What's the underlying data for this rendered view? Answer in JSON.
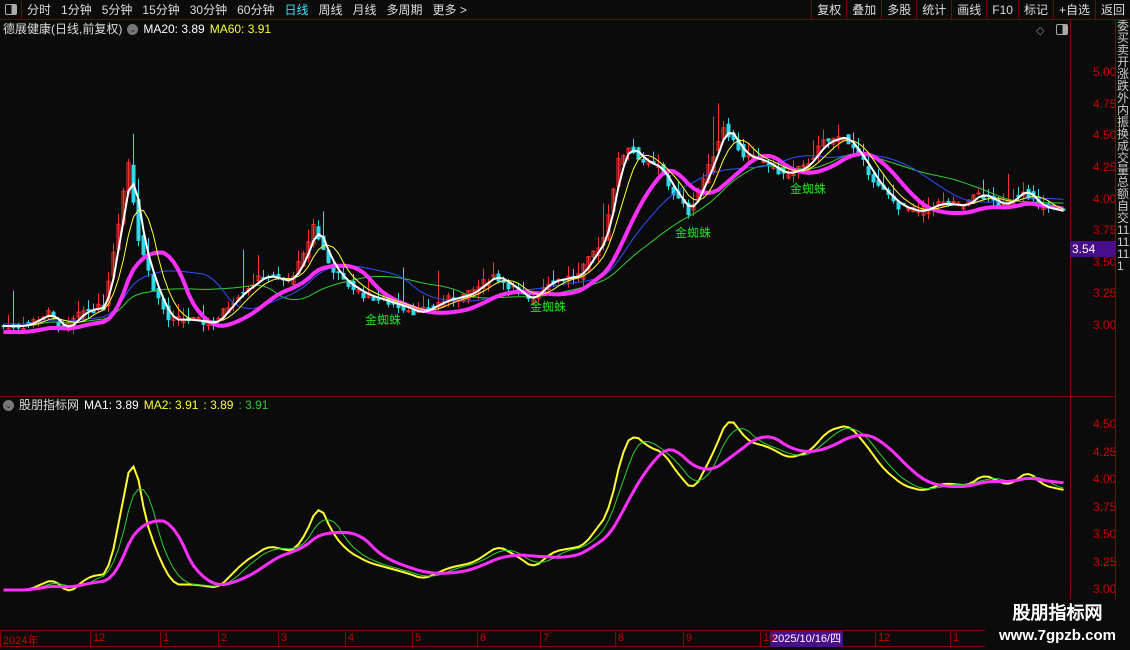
{
  "toolbar": {
    "periods": [
      "分时",
      "1分钟",
      "5分钟",
      "15分钟",
      "30分钟",
      "60分钟",
      "日线",
      "周线",
      "月线",
      "多周期",
      "更多 >"
    ],
    "active": "日线",
    "right_buttons": [
      "复权",
      "叠加",
      "多股",
      "统计",
      "画线",
      "F10",
      "标记",
      "+自选",
      "返回"
    ]
  },
  "main": {
    "title": "德展健康(日线,前复权)",
    "ma20": "MA20: 3.89",
    "ma60": "MA60: 3.91",
    "price_badge": "3.54",
    "y_ticks": [
      "5.00",
      "4.75",
      "4.50",
      "4.25",
      "4.00",
      "3.75",
      "3.50",
      "3.25",
      "3.00"
    ],
    "signals": [
      {
        "label": "金蜘蛛",
        "bar": 75
      },
      {
        "label": "金蜘蛛",
        "bar": 108
      },
      {
        "label": "金蜘蛛",
        "bar": 137
      },
      {
        "label": "金蜘蛛",
        "bar": 160
      }
    ]
  },
  "sub": {
    "title": "股朋指标网",
    "ma1": "MA1: 3.89",
    "ma2": "MA2: 3.91",
    "v3": ": 3.89",
    "v4": ": 3.91",
    "y_ticks": [
      "4.50",
      "4.25",
      "4.00",
      "3.75",
      "3.50",
      "3.25",
      "3.00"
    ]
  },
  "dates": {
    "labels": [
      "2024年",
      "12",
      "1",
      "2",
      "3",
      "4",
      "5",
      "6",
      "7",
      "8",
      "9",
      "10",
      "12",
      "1"
    ],
    "selected": "2025/10/16/四"
  },
  "right_column": "委买卖开涨跌外内振换成交量总额自交1111111",
  "watermark": {
    "line1": "股朋指标网",
    "line2": "www.7gpzb.com"
  },
  "colors": {
    "up": "#ff3030",
    "down": "#30d8e8",
    "ma_white": "#ffffff",
    "ma_yellow": "#ffff30",
    "ma_magenta": "#ff30ff",
    "ma_green": "#30d030",
    "ma_blue": "#3050ff"
  },
  "chart_data": {
    "type": "candlestick",
    "title": "德展健康 日线",
    "ylim": [
      2.7,
      5.4
    ],
    "anchors_bar": [
      0,
      4,
      9,
      12,
      16,
      20,
      22,
      25,
      27,
      30,
      33,
      37,
      42,
      47,
      52,
      57,
      60,
      62,
      65,
      68,
      72,
      76,
      80,
      83,
      88,
      93,
      98,
      102,
      105,
      109,
      115,
      120,
      123,
      125,
      128,
      131,
      134,
      137,
      141,
      144,
      148,
      152,
      156,
      160,
      164,
      168,
      171,
      175,
      179,
      183,
      187,
      192,
      195,
      200,
      204,
      207,
      212
    ],
    "anchors_close": [
      3.0,
      3.0,
      3.1,
      2.97,
      3.12,
      3.15,
      3.6,
      4.3,
      3.7,
      3.3,
      3.05,
      3.05,
      3.02,
      3.25,
      3.4,
      3.35,
      3.55,
      3.8,
      3.5,
      3.35,
      3.25,
      3.2,
      3.15,
      3.1,
      3.2,
      3.25,
      3.4,
      3.3,
      3.2,
      3.35,
      3.4,
      3.7,
      4.3,
      4.42,
      4.3,
      4.25,
      4.05,
      3.9,
      4.25,
      4.58,
      4.35,
      4.3,
      4.2,
      4.25,
      4.45,
      4.5,
      4.35,
      4.1,
      3.95,
      3.9,
      3.97,
      3.95,
      4.05,
      3.95,
      4.08,
      3.95,
      3.9
    ]
  }
}
